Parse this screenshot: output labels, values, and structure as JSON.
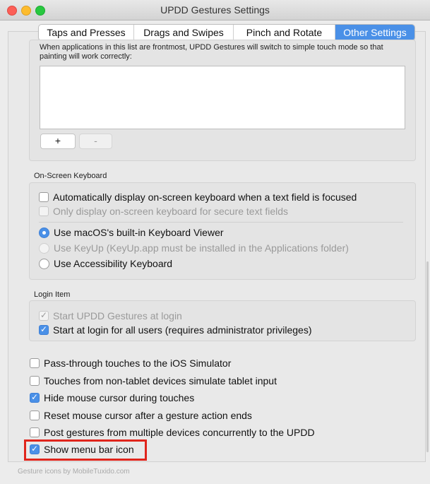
{
  "window": {
    "title": "UPDD Gestures Settings",
    "traffic_lights": {
      "close": "#fc5f57",
      "minimize": "#fdbc2e",
      "zoom": "#28c840"
    }
  },
  "tabs": [
    {
      "label": "Taps and Presses",
      "active": false
    },
    {
      "label": "Drags and Swipes",
      "active": false
    },
    {
      "label": "Pinch and Rotate",
      "active": false
    },
    {
      "label": "Other Settings",
      "active": true
    }
  ],
  "simple_touch": {
    "description": "When applications in this list are frontmost, UPDD Gestures will switch to simple touch mode so that painting will work correctly:",
    "add_label": "+",
    "remove_label": "-"
  },
  "keyboard": {
    "section_label": "On-Screen Keyboard",
    "auto_display": {
      "label": "Automatically display on-screen keyboard when a text field is focused",
      "checked": false
    },
    "secure_only": {
      "label": "Only display on-screen keyboard for secure text fields",
      "checked": false,
      "disabled": true
    },
    "radio_builtin": {
      "label": "Use macOS's built-in Keyboard Viewer",
      "selected": true
    },
    "radio_keyup": {
      "label": "Use KeyUp (KeyUp.app must be installed in the Applications folder)",
      "selected": false,
      "disabled": true
    },
    "radio_accessibility": {
      "label": "Use Accessibility Keyboard",
      "selected": false
    }
  },
  "login": {
    "section_label": "Login Item",
    "start_at_login": {
      "label": "Start UPDD Gestures at login",
      "checked": true,
      "disabled": true
    },
    "all_users": {
      "label": "Start at login for all users (requires administrator privileges)",
      "checked": true
    }
  },
  "options": [
    {
      "label": "Pass-through touches to the iOS Simulator",
      "checked": false
    },
    {
      "label": "Touches from non-tablet devices simulate tablet input",
      "checked": false
    },
    {
      "label": "Hide mouse cursor during touches",
      "checked": true
    },
    {
      "label": "Reset mouse cursor after a gesture action ends",
      "checked": false
    },
    {
      "label": "Post gestures from multiple devices concurrently to the UPDD",
      "checked": false
    },
    {
      "label": "Show menu bar icon",
      "checked": true
    }
  ],
  "highlight_color": "#e0251c",
  "accent_color": "#4a90e7",
  "footer": {
    "credit": "Gesture icons by MobileTuxido.com"
  }
}
